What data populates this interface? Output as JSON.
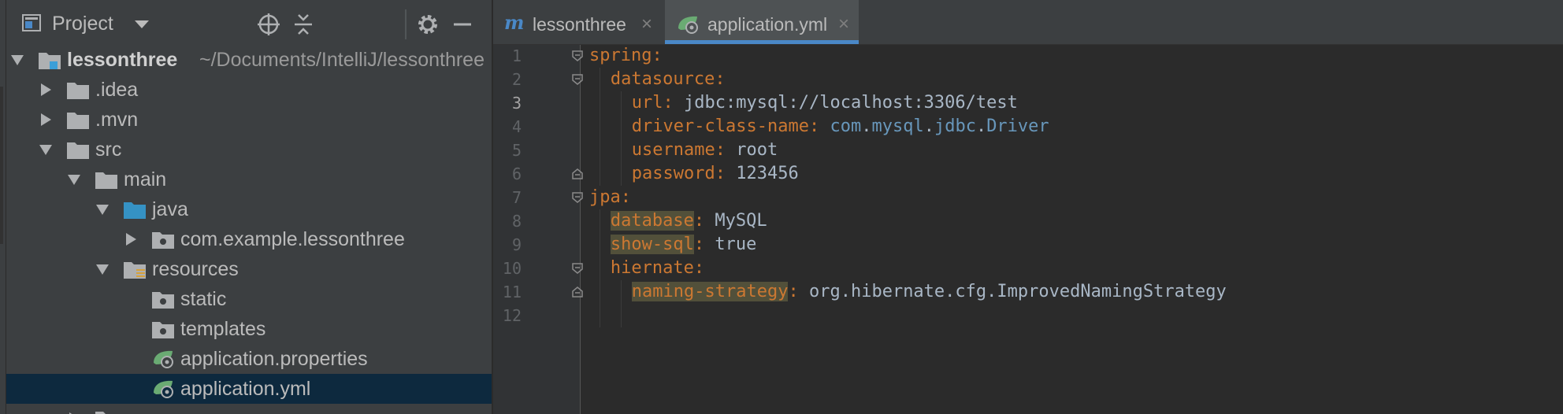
{
  "project_panel": {
    "title": "Project",
    "header_icons": [
      "locate-icon",
      "collapse-all-icon",
      "gear-icon",
      "minimize-icon"
    ],
    "tree": [
      {
        "label": "lessonthree",
        "path": "~/Documents/IntelliJ/lessonthree",
        "icon": "module-folder-icon",
        "expanded": true
      },
      {
        "label": ".idea",
        "icon": "folder-icon",
        "expanded": false
      },
      {
        "label": ".mvn",
        "icon": "folder-icon",
        "expanded": false
      },
      {
        "label": "src",
        "icon": "folder-icon",
        "expanded": true
      },
      {
        "label": "main",
        "icon": "folder-icon",
        "expanded": true
      },
      {
        "label": "java",
        "icon": "source-folder-icon",
        "expanded": true
      },
      {
        "label": "com.example.lessonthree",
        "icon": "package-icon",
        "expanded": false
      },
      {
        "label": "resources",
        "icon": "resources-folder-icon",
        "expanded": true
      },
      {
        "label": "static",
        "icon": "package-icon"
      },
      {
        "label": "templates",
        "icon": "package-icon"
      },
      {
        "label": "application.properties",
        "icon": "spring-config-icon"
      },
      {
        "label": "application.yml",
        "icon": "spring-config-icon",
        "selected": true
      }
    ]
  },
  "editor": {
    "tabs": [
      {
        "label": "lessonthree",
        "icon": "maven-icon",
        "active": false
      },
      {
        "label": "application.yml",
        "icon": "spring-config-icon",
        "active": true
      }
    ],
    "current_line": 3,
    "line_numbers": [
      "1",
      "2",
      "3",
      "4",
      "5",
      "6",
      "7",
      "8",
      "9",
      "10",
      "11",
      "12"
    ],
    "lines": [
      {
        "key": "spring",
        "sep": ":",
        "value": ""
      },
      {
        "key": "datasource",
        "sep": ":",
        "value": ""
      },
      {
        "key": "url",
        "sep": ": ",
        "value": "jdbc:mysql://localhost:3306/test"
      },
      {
        "key": "driver-class-name",
        "sep": ": ",
        "value": "com.mysql.jdbc.Driver"
      },
      {
        "key": "username",
        "sep": ": ",
        "value": "root"
      },
      {
        "key": "password",
        "sep": ": ",
        "value": "123456"
      },
      {
        "key": "jpa",
        "sep": ":",
        "value": ""
      },
      {
        "key": "database",
        "sep": ": ",
        "value": "MySQL"
      },
      {
        "key": "show-sql",
        "sep": ": ",
        "value": "true"
      },
      {
        "key": "hiernate",
        "sep": ":",
        "value": ""
      },
      {
        "key": "naming-strategy",
        "sep": ": ",
        "value": "org.hibernate.cfg.ImprovedNamingStrategy"
      },
      {
        "key": "",
        "sep": "",
        "value": ""
      }
    ],
    "colors": {
      "key": "#cc7832",
      "value": "#a9b7c6",
      "class_ref": "#6897bb",
      "warning_highlight": "#52503a"
    }
  }
}
